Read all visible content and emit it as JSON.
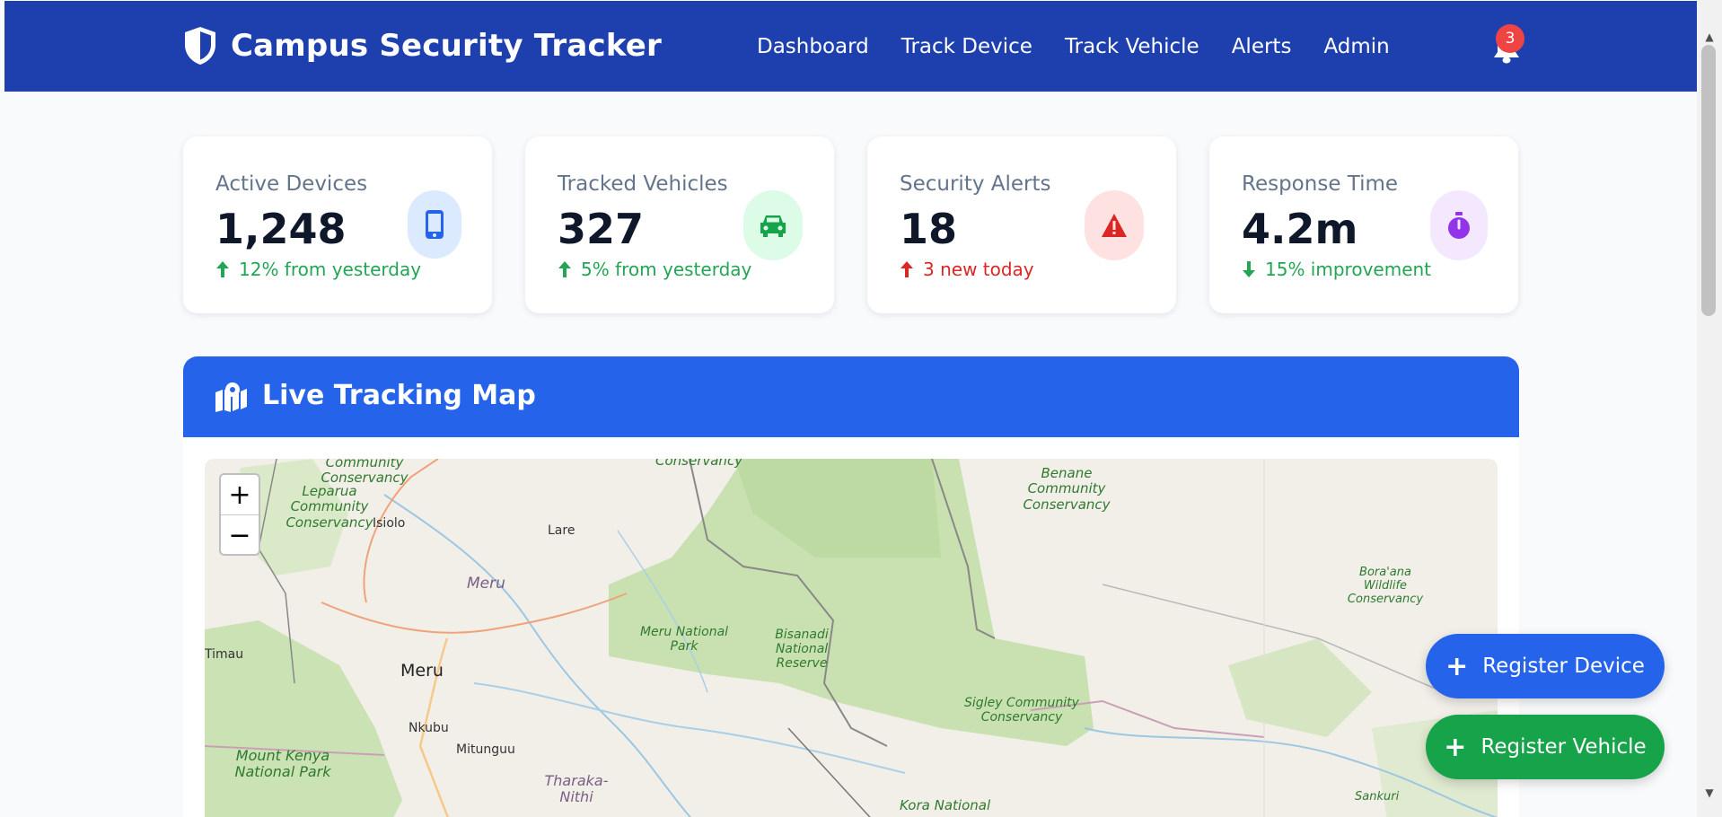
{
  "header": {
    "title": "Campus Security Tracker",
    "nav": [
      "Dashboard",
      "Track Device",
      "Track Vehicle",
      "Alerts",
      "Admin"
    ],
    "notification_count": "3"
  },
  "stats": [
    {
      "label": "Active Devices",
      "value": "1,248",
      "trend": "12% from yesterday",
      "direction": "up",
      "tone": "#22a653",
      "icon": "mobile-icon",
      "icon_bg": "#dbeafe",
      "icon_color": "#2563eb"
    },
    {
      "label": "Tracked Vehicles",
      "value": "327",
      "trend": "5% from yesterday",
      "direction": "up",
      "tone": "#22a653",
      "icon": "car-icon",
      "icon_bg": "#dcfce7",
      "icon_color": "#16a34a"
    },
    {
      "label": "Security Alerts",
      "value": "18",
      "trend": "3 new today",
      "direction": "up",
      "tone": "#dc2626",
      "icon": "warning-icon",
      "icon_bg": "#fee2e2",
      "icon_color": "#dc2626"
    },
    {
      "label": "Response Time",
      "value": "4.2m",
      "trend": "15% improvement",
      "direction": "down",
      "tone": "#22a653",
      "icon": "stopwatch-icon",
      "icon_bg": "#f3e8ff",
      "icon_color": "#9333ea"
    }
  ],
  "map": {
    "title": "Live Tracking Map",
    "zoom_in": "+",
    "zoom_out": "−",
    "labels": {
      "community_conservancy_1": "Community Conservancy",
      "leparua": "Leparua Community Conservancy",
      "isiolo": "Isiolo",
      "conservancy_top": "Conservancy",
      "lare": "Lare",
      "benane": "Benane Community Conservancy",
      "boraana": "Bora'ana Wildlife Conservancy",
      "meru_region": "Meru",
      "meru_park": "Meru National Park",
      "bisanadi": "Bisanadi National Reserve",
      "timau": "Timau",
      "meru_city": "Meru",
      "sigley": "Sigley Community Conservancy",
      "nkubu": "Nkubu",
      "mitunguu": "Mitunguu",
      "mount_kenya": "Mount Kenya National Park",
      "tharaka": "Tharaka- Nithi",
      "kora": "Kora National",
      "sankuri": "Sankuri"
    }
  },
  "actions": {
    "register_device": "Register Device",
    "register_vehicle": "Register Vehicle"
  },
  "colors": {
    "header": "#1e40af",
    "map_header": "#2563eb",
    "up_green": "#22a653",
    "alert_red": "#dc2626"
  }
}
